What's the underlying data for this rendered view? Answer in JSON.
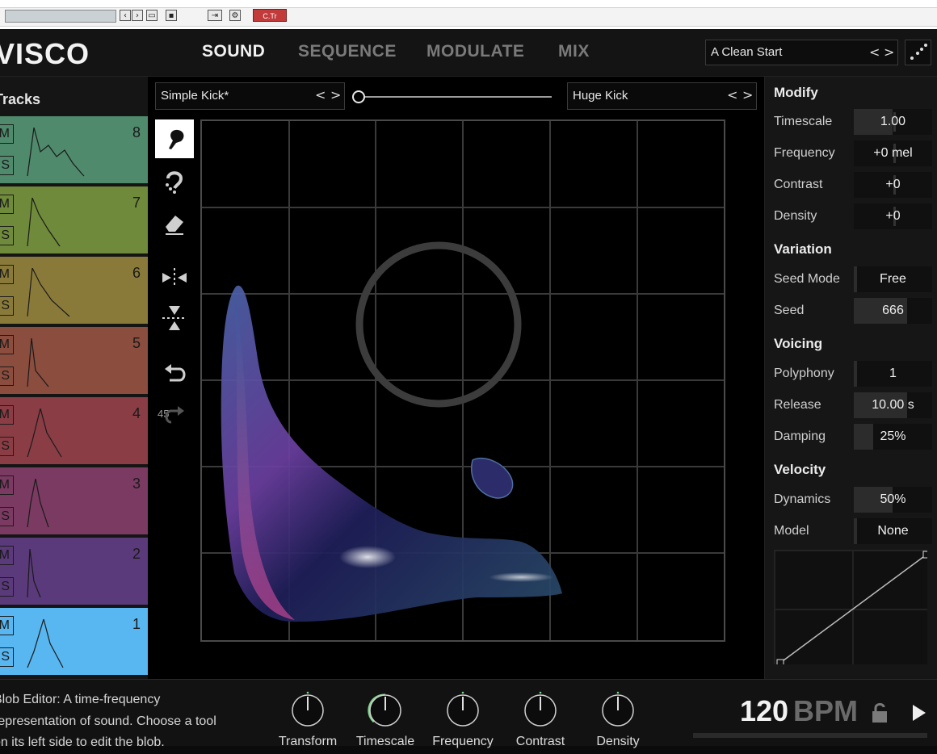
{
  "host": {
    "plugin_badge": "C.Tr"
  },
  "app": {
    "logo": "VISCO",
    "tabs": [
      {
        "label": "SOUND",
        "active": true
      },
      {
        "label": "SEQUENCE",
        "active": false
      },
      {
        "label": "MODULATE",
        "active": false
      },
      {
        "label": "MIX",
        "active": false
      }
    ],
    "preset": {
      "name": "A Clean Start",
      "prev": "<",
      "next": ">"
    }
  },
  "tracks": {
    "title": "Tracks",
    "mute_label": "M",
    "solo_label": "S",
    "items": [
      {
        "number": "8",
        "color": "#4f8a6c"
      },
      {
        "number": "7",
        "color": "#6e8a3a"
      },
      {
        "number": "6",
        "color": "#8a7a3a"
      },
      {
        "number": "5",
        "color": "#8a4d3e"
      },
      {
        "number": "4",
        "color": "#8a3d45"
      },
      {
        "number": "3",
        "color": "#7a3a62"
      },
      {
        "number": "2",
        "color": "#5a3a7a"
      },
      {
        "number": "1",
        "color": "#58b6f0",
        "selected": true
      }
    ]
  },
  "editor": {
    "source_a": "Simple Kick*",
    "source_b": "Huge Kick",
    "morph": 0,
    "undo_count": "45",
    "tools": [
      "brush-icon",
      "magnet-icon",
      "eraser-icon",
      "mirror-horizontal-icon",
      "mirror-vertical-icon",
      "undo-icon",
      "redo-icon"
    ]
  },
  "params": {
    "sections": {
      "modify": "Modify",
      "variation": "Variation",
      "voicing": "Voicing",
      "velocity": "Velocity"
    },
    "timescale": {
      "label": "Timescale",
      "value": "1.00"
    },
    "frequency": {
      "label": "Frequency",
      "value": "+0 mel"
    },
    "contrast": {
      "label": "Contrast",
      "value": "+0"
    },
    "density": {
      "label": "Density",
      "value": "+0"
    },
    "seed_mode": {
      "label": "Seed Mode",
      "value": "Free"
    },
    "seed": {
      "label": "Seed",
      "value": "666"
    },
    "polyphony": {
      "label": "Polyphony",
      "value": "1"
    },
    "release": {
      "label": "Release",
      "value": "10.00 s"
    },
    "damping": {
      "label": "Damping",
      "value": "25%"
    },
    "dynamics": {
      "label": "Dynamics",
      "value": "50%"
    },
    "model": {
      "label": "Model",
      "value": "None"
    }
  },
  "footer": {
    "description": [
      "Blob Editor: A time-frequency",
      "representation of sound. Choose a tool",
      "on its left side to edit the blob."
    ],
    "knobs": [
      {
        "label": "Transform",
        "active": false
      },
      {
        "label": "Timescale",
        "active": true
      },
      {
        "label": "Frequency",
        "active": false
      },
      {
        "label": "Contrast",
        "active": false
      },
      {
        "label": "Density",
        "active": false
      }
    ],
    "bpm_value": "120",
    "bpm_unit": "BPM"
  }
}
